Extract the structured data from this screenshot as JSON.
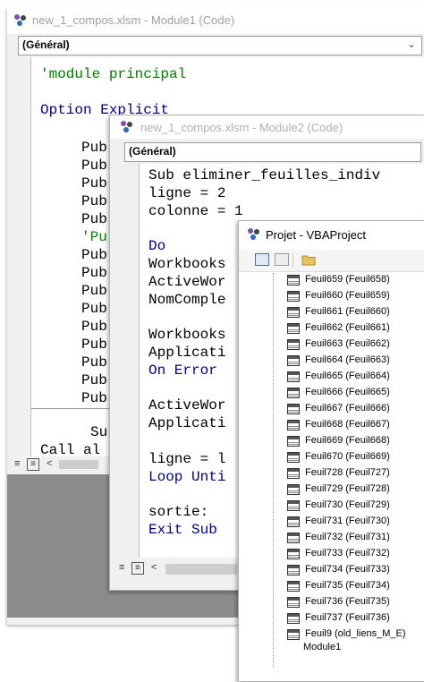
{
  "window1": {
    "title": "new_1_compos.xlsm - Module1 (Code)",
    "combo": "(Général)",
    "code_lines": [
      {
        "text": "'module principal",
        "kind": "comment"
      },
      {
        "text": "Option Explicit",
        "kind": "keyword"
      },
      {
        "text": "Pub",
        "kind": "normal"
      },
      {
        "text": "Pub",
        "kind": "normal"
      },
      {
        "text": "Pub",
        "kind": "normal"
      },
      {
        "text": "Pub",
        "kind": "normal"
      },
      {
        "text": "Pub",
        "kind": "normal"
      },
      {
        "text": "'Pu",
        "kind": "comment"
      },
      {
        "text": "Pub",
        "kind": "normal"
      },
      {
        "text": "Pub",
        "kind": "normal"
      },
      {
        "text": "Pub",
        "kind": "normal"
      },
      {
        "text": "Pub",
        "kind": "normal"
      },
      {
        "text": "Pub",
        "kind": "normal"
      },
      {
        "text": "Pub",
        "kind": "normal"
      },
      {
        "text": "Pub",
        "kind": "normal"
      },
      {
        "text": "Pub",
        "kind": "normal"
      },
      {
        "text": "Pub",
        "kind": "normal"
      }
    ],
    "lower_lines": [
      {
        "text": "Su",
        "kind": "normal"
      },
      {
        "text": "Call al",
        "kind": "normal"
      }
    ]
  },
  "window2": {
    "title": "new_1_compos.xlsm - Module2 (Code)",
    "combo": "(Général)",
    "code_lines": [
      {
        "text": "Sub eliminer_feuilles_indiv",
        "kind": "normal"
      },
      {
        "text": "ligne = 2",
        "kind": "normal"
      },
      {
        "text": "colonne = 1",
        "kind": "normal"
      },
      {
        "text": "",
        "kind": "normal"
      },
      {
        "text": "Do",
        "kind": "keyword"
      },
      {
        "text": "Workbooks",
        "kind": "normal"
      },
      {
        "text": "ActiveWor",
        "kind": "normal"
      },
      {
        "text": "NomComple",
        "kind": "normal"
      },
      {
        "text": "",
        "kind": "normal"
      },
      {
        "text": "Workbooks",
        "kind": "normal"
      },
      {
        "text": "Applicati",
        "kind": "normal"
      },
      {
        "text": "On Error",
        "kind": "keyword"
      },
      {
        "text": "",
        "kind": "normal"
      },
      {
        "text": "ActiveWor",
        "kind": "normal"
      },
      {
        "text": "Applicati",
        "kind": "normal"
      },
      {
        "text": "",
        "kind": "normal"
      },
      {
        "text": "ligne = l",
        "kind": "normal"
      },
      {
        "text": "Loop Unti",
        "kind": "keyword"
      },
      {
        "text": "",
        "kind": "normal"
      },
      {
        "text": "sortie:",
        "kind": "normal"
      },
      {
        "text": "Exit Sub",
        "kind": "keyword"
      }
    ]
  },
  "project": {
    "title": "Projet - VBAProject",
    "items": [
      "Feuil659 (Feuil658)",
      "Feuil660 (Feuil659)",
      "Feuil661 (Feuil660)",
      "Feuil662 (Feuil661)",
      "Feuil663 (Feuil662)",
      "Feuil664 (Feuil663)",
      "Feuil665 (Feuil664)",
      "Feuil666 (Feuil665)",
      "Feuil667 (Feuil666)",
      "Feuil668 (Feuil667)",
      "Feuil669 (Feuil668)",
      "Feuil670 (Feuil669)",
      "Feuil728 (Feuil727)",
      "Feuil729 (Feuil728)",
      "Feuil730 (Feuil729)",
      "Feuil731 (Feuil730)",
      "Feuil732 (Feuil731)",
      "Feuil733 (Feuil732)",
      "Feuil734 (Feuil733)",
      "Feuil735 (Feuil734)",
      "Feuil736 (Feuil735)",
      "Feuil737 (Feuil736)",
      "Feuil9 (old_liens_M_E)"
    ],
    "module_label": "Module1"
  },
  "colors": {
    "keyword": "#000080",
    "comment": "#008000",
    "text": "#000000"
  },
  "icons": {
    "vba": "vba-project-icon",
    "sheet": "worksheet-icon",
    "folder": "folder-icon"
  }
}
